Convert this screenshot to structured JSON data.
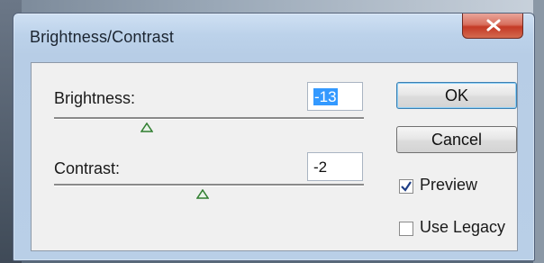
{
  "dialog": {
    "title": "Brightness/Contrast",
    "close_icon": "close-icon"
  },
  "brightness": {
    "label": "Brightness:",
    "value": "-13",
    "slider_position": 0.3
  },
  "contrast": {
    "label": "Contrast:",
    "value": "-2",
    "slider_position": 0.48
  },
  "buttons": {
    "ok": "OK",
    "cancel": "Cancel"
  },
  "options": {
    "preview": {
      "label": "Preview",
      "checked": true
    },
    "use_legacy": {
      "label": "Use Legacy",
      "checked": false
    }
  },
  "colors": {
    "selection": "#3399ff",
    "close_button": "#c43a26",
    "default_button_border": "#3c7fb1",
    "slider_thumb": "#2f7d2f"
  }
}
